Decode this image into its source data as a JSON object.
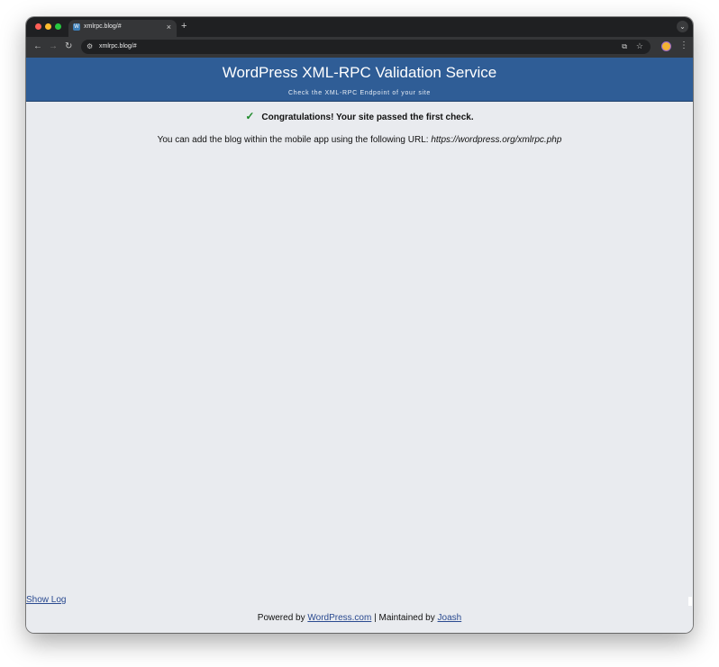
{
  "browser": {
    "tab": {
      "favicon": "W",
      "title": "xmlrpc.blog/#",
      "close_glyph": "×"
    },
    "new_tab_glyph": "+",
    "tab_menu_glyph": "⌄",
    "url": "xmlrpc.blog/#",
    "icons": {
      "back": "←",
      "forward": "→",
      "reload": "↻",
      "site_info": "⚙",
      "translate": "⧉",
      "bookmark": "☆",
      "menu": "⋮"
    }
  },
  "page": {
    "title": "WordPress XML-RPC Validation Service",
    "subtitle": "Check the XML-RPC Endpoint of your site",
    "success_check": "✓",
    "success_message": "Congratulations! Your site passed the first check.",
    "info_text": "You can add the blog within the mobile app using the following URL: ",
    "endpoint_url": "https://wordpress.org/xmlrpc.php",
    "show_log_label": "Show Log",
    "footer": {
      "powered_by": "Powered by ",
      "wordpress_link": "WordPress.com",
      "separator": " | Maintained by ",
      "maintainer_link": "Joash"
    }
  },
  "colors": {
    "header_bg": "#2f5d96",
    "page_bg": "#e9ebef",
    "link": "#2a4a90",
    "check": "#1f8b2b"
  }
}
